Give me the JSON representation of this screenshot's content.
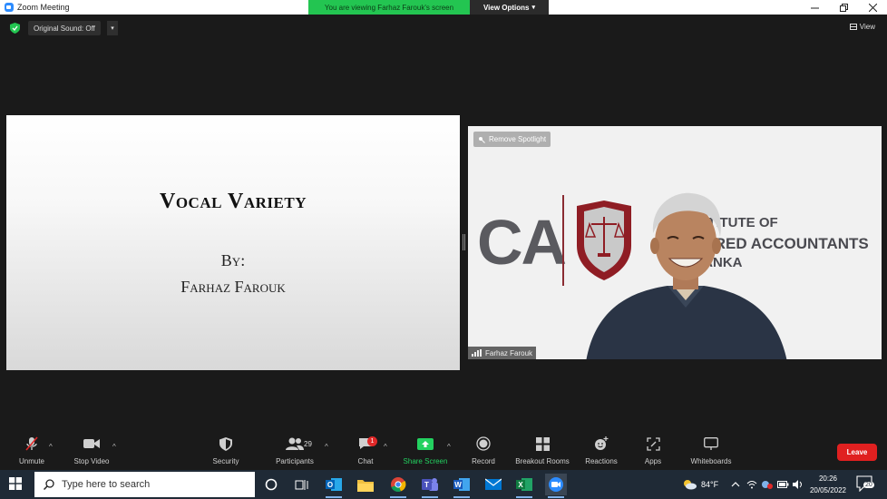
{
  "window": {
    "title": "Zoom Meeting",
    "viewing_banner": "You are viewing Farhaz Farouk's screen",
    "view_options": "View Options"
  },
  "top_bar": {
    "original_sound": "Original Sound: Off",
    "view_label": "View"
  },
  "slide": {
    "title": "Vocal Variety",
    "by": "By:",
    "presenter": "Farhaz Farouk"
  },
  "video": {
    "remove_spotlight": "Remove Spotlight",
    "participant_name": "Farhaz Farouk",
    "background_logo": {
      "letters": "CA",
      "line1": "ISTITUTE OF",
      "line2": "TERED ACCOUNTANTS",
      "line3": "LANKA"
    }
  },
  "toolbar": {
    "unmute": "Unmute",
    "stop_video": "Stop Video",
    "security": "Security",
    "participants": "Participants",
    "participants_count": "29",
    "chat": "Chat",
    "chat_badge": "1",
    "share_screen": "Share Screen",
    "record": "Record",
    "breakout_rooms": "Breakout Rooms",
    "reactions": "Reactions",
    "apps": "Apps",
    "whiteboards": "Whiteboards",
    "leave": "Leave"
  },
  "taskbar": {
    "search_placeholder": "Type here to search",
    "temperature": "84°F",
    "time": "20:26",
    "date": "20/05/2022",
    "notification_count": "20"
  },
  "colors": {
    "banner_green": "#23c551",
    "leave_red": "#e02020",
    "zoom_blue": "#2d8cff",
    "taskbar_bg": "#1f2a36"
  }
}
